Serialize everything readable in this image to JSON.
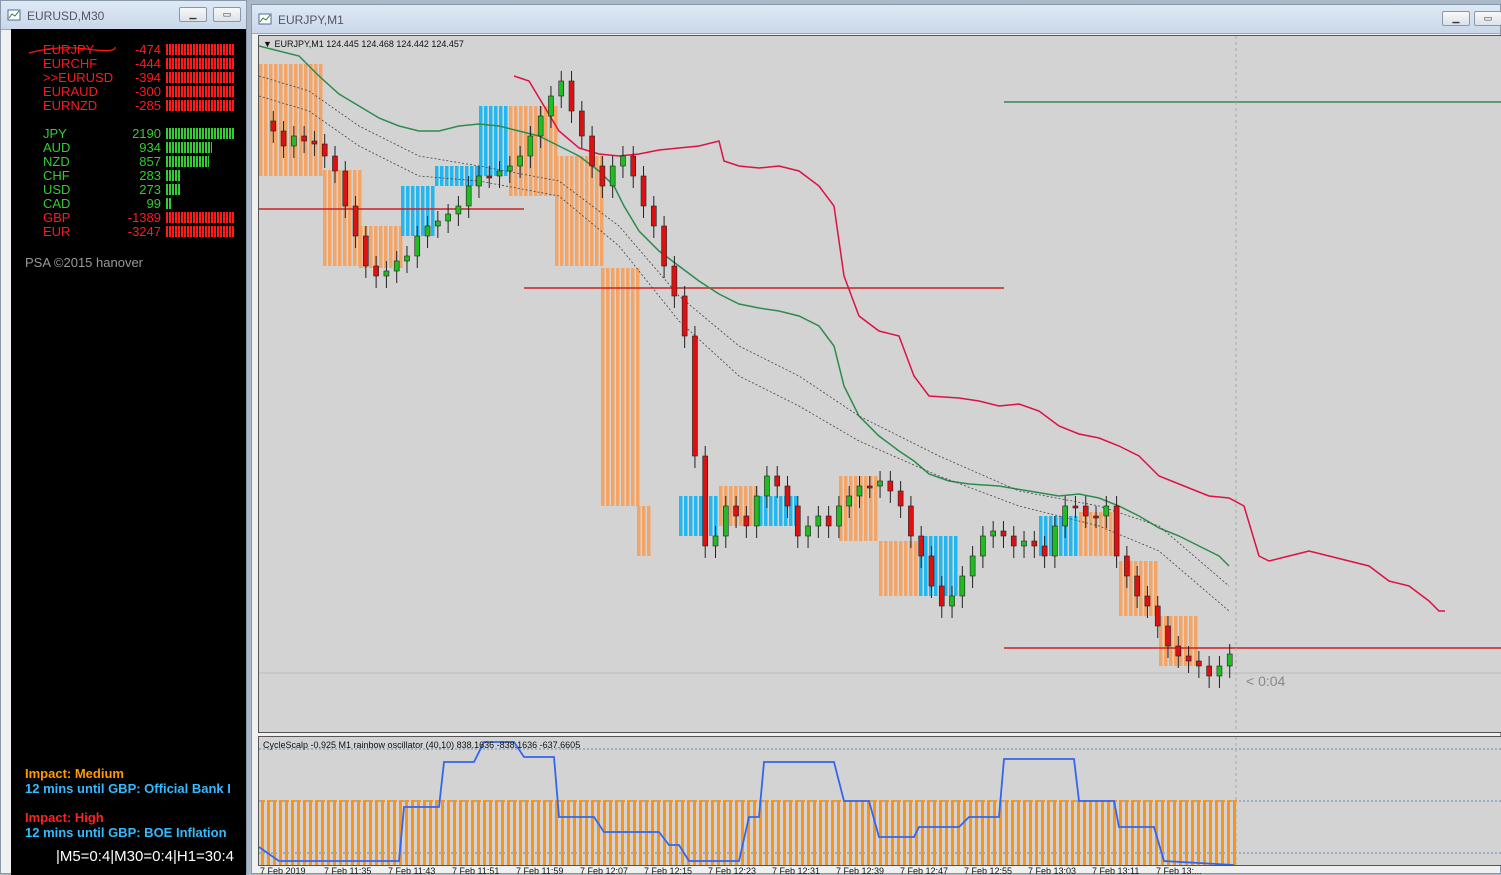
{
  "left_window": {
    "title": "EURUSD,M30",
    "pairs": [
      {
        "name": "EURJPY",
        "value": "-474",
        "color": "#ff1a1a",
        "strength": 1.0
      },
      {
        "name": "EURCHF",
        "value": "-444",
        "color": "#ff1a1a",
        "strength": 1.0
      },
      {
        "name": ">>EURUSD",
        "value": "-394",
        "color": "#ff1a1a",
        "strength": 1.0
      },
      {
        "name": "EURAUD",
        "value": "-300",
        "color": "#ff1a1a",
        "strength": 1.0
      },
      {
        "name": "EURNZD",
        "value": "-285",
        "color": "#ff1a1a",
        "strength": 1.0
      }
    ],
    "currencies": [
      {
        "name": "JPY",
        "value": "2190",
        "color": "#33cc33",
        "strength": 1.0
      },
      {
        "name": "AUD",
        "value": "934",
        "color": "#33cc33",
        "strength": 0.68
      },
      {
        "name": "NZD",
        "value": "857",
        "color": "#33cc33",
        "strength": 0.63
      },
      {
        "name": "CHF",
        "value": "283",
        "color": "#33cc33",
        "strength": 0.2
      },
      {
        "name": "USD",
        "value": "273",
        "color": "#33cc33",
        "strength": 0.2
      },
      {
        "name": "CAD",
        "value": "99",
        "color": "#33cc33",
        "strength": 0.08
      },
      {
        "name": "GBP",
        "value": "-1389",
        "color": "#ff1a1a",
        "strength": 1.0
      },
      {
        "name": "EUR",
        "value": "-3247",
        "color": "#ff1a1a",
        "strength": 1.0
      }
    ],
    "copyright": "PSA ©2015 hanover",
    "news": [
      {
        "impact": "Impact: Medium",
        "impact_color": "#ff9900",
        "text": "12 mins until GBP: Official Bank I"
      },
      {
        "impact": "Impact: High",
        "impact_color": "#ff2222",
        "text": "12 mins until GBP: BOE Inflation"
      }
    ],
    "timers": "|M5=0:4|M30=0:4|H1=30:4"
  },
  "right_window": {
    "title": "EURJPY,M1",
    "chart_header": "EURJPY,M1  124.445 124.468 124.442 124.457",
    "countdown": "< 0:04",
    "oscillator_header": "CycleScalp -0.925  M1 rainbow oscillator (40,10) 838.1636 -838.1636 -637.6605",
    "time_labels": [
      "7 Feb 2019",
      "7 Feb 11:35",
      "7 Feb 11:43",
      "7 Feb 11:51",
      "7 Feb 11:59",
      "7 Feb 12:07",
      "7 Feb 12:15",
      "7 Feb 12:23",
      "7 Feb 12:31",
      "7 Feb 12:39",
      "7 Feb 12:47",
      "7 Feb 12:55",
      "7 Feb 13:03",
      "7 Feb 13:11",
      "7 Feb 13:..."
    ]
  },
  "colors": {
    "bull": "#22bb22",
    "bear": "#dd1111",
    "orange_box": "#f4a566",
    "blue_box": "#22b7ee",
    "red_line": "#dd1144",
    "green_line": "#2e8b4e",
    "level_line": "#cc2222",
    "osc_line": "#3366ee",
    "osc_bars": "#f7941d"
  }
}
